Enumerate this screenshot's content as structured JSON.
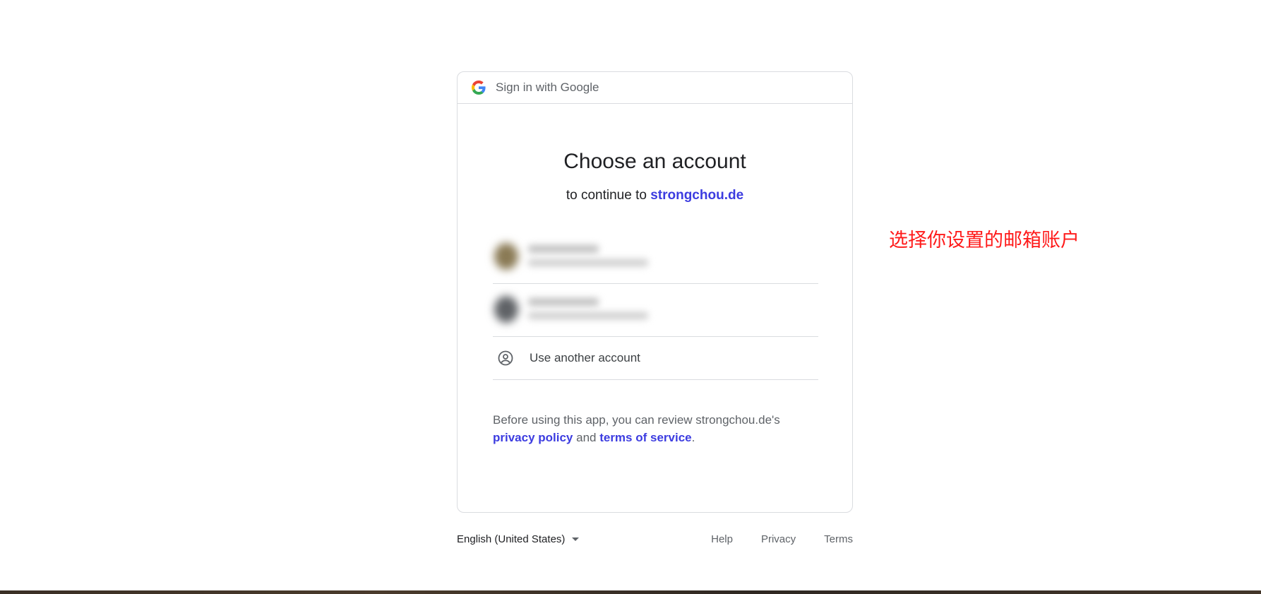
{
  "header": {
    "text": "Sign in with Google",
    "logo_icon": "google-g-icon"
  },
  "main": {
    "title": "Choose an account",
    "subtitle_prefix": "to continue to ",
    "subtitle_link": "strongchou.de"
  },
  "accounts": [
    {
      "avatar_color": "#8a7a55",
      "blurred": true
    },
    {
      "avatar_color": "#5f6266",
      "blurred": true
    }
  ],
  "another_account": {
    "label": "Use another account",
    "icon": "account-circle-icon"
  },
  "legal": {
    "prefix": "Before using this app, you can review strongchou.de's",
    "privacy_link": "privacy policy",
    "and_text": " and ",
    "terms_link": "terms of service",
    "suffix": "."
  },
  "footer": {
    "language": "English (United States)",
    "links": [
      "Help",
      "Privacy",
      "Terms"
    ]
  },
  "annotation": {
    "text": "选择你设置的邮箱账户",
    "color": "#ff1a1a"
  },
  "colors": {
    "link": "#3c3ce0",
    "border": "#dadce0"
  }
}
